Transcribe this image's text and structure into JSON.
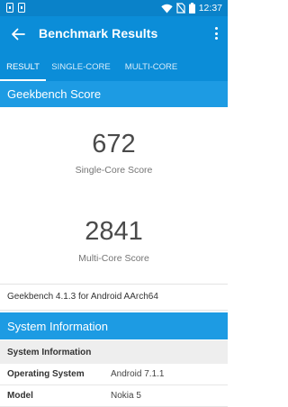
{
  "status_bar": {
    "left_icons": [
      "sim-card-icon",
      "notification-icon"
    ],
    "right_icons": [
      "wifi-icon",
      "no-sim-icon",
      "battery-icon"
    ],
    "time": "12:37"
  },
  "app_bar": {
    "title": "Benchmark Results",
    "back_icon": "arrow-back-icon",
    "menu_icon": "more-vert-icon"
  },
  "tabs": [
    {
      "label": "RESULT",
      "active": true
    },
    {
      "label": "SINGLE-CORE",
      "active": false
    },
    {
      "label": "MULTI-CORE",
      "active": false
    }
  ],
  "geekbench": {
    "heading": "Geekbench Score",
    "single_core": {
      "value": "672",
      "label": "Single-Core Score"
    },
    "multi_core": {
      "value": "2841",
      "label": "Multi-Core Score"
    },
    "version": "Geekbench 4.1.3 for Android AArch64"
  },
  "system": {
    "heading": "System Information",
    "table_header": "System Information",
    "rows": [
      {
        "key": "Operating System",
        "value": "Android 7.1.1"
      },
      {
        "key": "Model",
        "value": "Nokia 5"
      }
    ]
  },
  "colors": {
    "status_bar": "#0a82c9",
    "app_bar": "#0b8dd8",
    "section_header": "#1d9be3"
  }
}
